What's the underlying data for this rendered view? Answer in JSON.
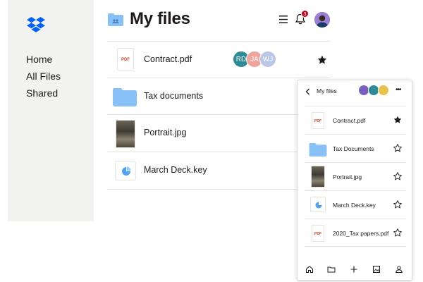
{
  "app": {
    "page_title": "My files",
    "notification_count": "3"
  },
  "sidebar": {
    "items": [
      {
        "label": "Home"
      },
      {
        "label": "All Files"
      },
      {
        "label": "Shared"
      }
    ]
  },
  "files": [
    {
      "name": "Contract.pdf",
      "type": "pdf",
      "thumb_label": "PDF",
      "starred": true,
      "collaborators": [
        {
          "initials": "RD",
          "color": "#2d8a96"
        },
        {
          "initials": "JA",
          "color": "#f0a39a"
        },
        {
          "initials": "WJ",
          "color": "#b9c7e6"
        }
      ]
    },
    {
      "name": "Tax documents",
      "type": "folder",
      "starred": false
    },
    {
      "name": "Portrait.jpg",
      "type": "image",
      "starred": false
    },
    {
      "name": "March Deck.key",
      "type": "keynote",
      "starred": false
    }
  ],
  "mobile": {
    "title": "My files",
    "members": [
      {
        "color": "#7a5fc0"
      },
      {
        "color": "#2d8a96"
      },
      {
        "color": "#e8c34a"
      }
    ],
    "files": [
      {
        "name": "Contract.pdf",
        "type": "pdf",
        "thumb_label": "PDF",
        "starred": true
      },
      {
        "name": "Tax Documents",
        "type": "folder",
        "starred": false
      },
      {
        "name": "Portrait.jpg",
        "type": "image",
        "starred": false
      },
      {
        "name": "March Deck.key",
        "type": "keynote",
        "starred": false
      },
      {
        "name": "2020_Tax papers.pdf",
        "type": "pdf",
        "thumb_label": "PDF",
        "starred": false
      }
    ]
  },
  "colors": {
    "brand": "#0061fe",
    "folder": "#88c1f8",
    "sidebar_bg": "#f2f2f1",
    "badge": "#c4001a"
  }
}
